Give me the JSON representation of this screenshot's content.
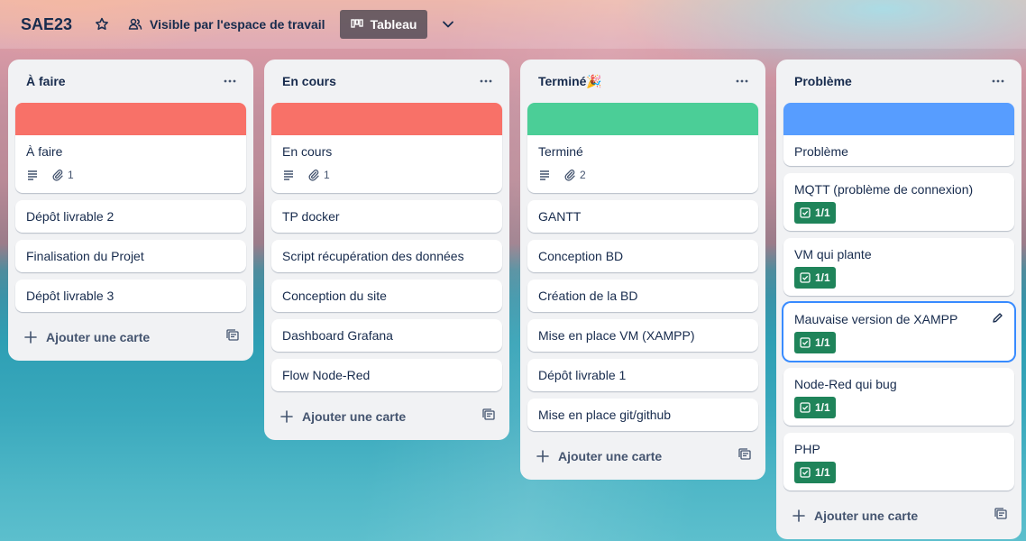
{
  "header": {
    "board_title": "SAE23",
    "visibility": "Visible par l'espace de travail",
    "view": "Tableau",
    "icons": [
      "star-icon",
      "people-icon",
      "board-view-icon",
      "chevron-down-icon"
    ]
  },
  "colors": {
    "red_cover": "#f87168",
    "green_cover": "#4bce97",
    "blue_cover": "#579dff",
    "checklist_badge": "#1f845a",
    "selected_outline": "#388bff"
  },
  "add_card_label": "Ajouter une carte",
  "lists": [
    {
      "title": "À faire",
      "cards": [
        {
          "title": "À faire",
          "cover": "#f87168",
          "description": true,
          "attachments": "1"
        },
        {
          "title": "Dépôt livrable 2"
        },
        {
          "title": "Finalisation du Projet"
        },
        {
          "title": "Dépôt livrable 3"
        }
      ]
    },
    {
      "title": "En cours",
      "cards": [
        {
          "title": "En cours",
          "cover": "#f87168",
          "description": true,
          "attachments": "1"
        },
        {
          "title": "TP docker"
        },
        {
          "title": "Script récupération des données"
        },
        {
          "title": "Conception du site"
        },
        {
          "title": "Dashboard Grafana"
        },
        {
          "title": "Flow Node-Red"
        }
      ]
    },
    {
      "title": "Terminé🎉",
      "cards": [
        {
          "title": "Terminé",
          "cover": "#4bce97",
          "description": true,
          "attachments": "2"
        },
        {
          "title": "GANTT"
        },
        {
          "title": "Conception BD"
        },
        {
          "title": "Création de la BD"
        },
        {
          "title": "Mise en place VM (XAMPP)"
        },
        {
          "title": "Dépôt livrable 1"
        },
        {
          "title": "Mise en place git/github"
        }
      ]
    },
    {
      "title": "Problème",
      "cards": [
        {
          "title": "Problème",
          "cover": "#579dff"
        },
        {
          "title": "MQTT (problème de connexion)",
          "checklist": "1/1"
        },
        {
          "title": "VM qui plante",
          "checklist": "1/1"
        },
        {
          "title": "Mauvaise version de XAMPP",
          "checklist": "1/1",
          "selected": true
        },
        {
          "title": "Node-Red qui bug",
          "checklist": "1/1"
        },
        {
          "title": "PHP",
          "checklist": "1/1"
        }
      ]
    }
  ]
}
